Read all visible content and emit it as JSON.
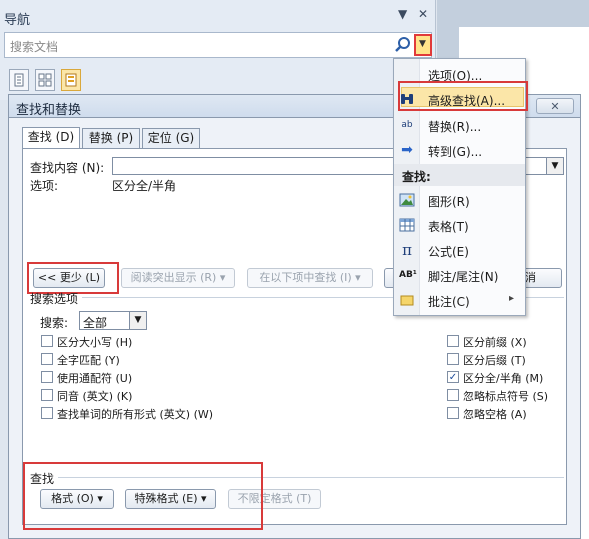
{
  "nav": {
    "title": "导航",
    "menu_glyph": "▼",
    "close_glyph": "✕",
    "search_placeholder": "搜索文档"
  },
  "dialog": {
    "title": "查找和替换",
    "close_glyph": "✕",
    "tabs": [
      {
        "label": "查找 (D)"
      },
      {
        "label": "替换 (P)"
      },
      {
        "label": "定位 (G)"
      }
    ],
    "find_label": "查找内容 (N):",
    "find_value": "",
    "options_label": "选项:",
    "options_value": "区分全/半角",
    "less_button": "<< 更少 (L)",
    "reading_highlight_button": "阅读突出显示 (R) ▾",
    "find_in_button": "在以下项中查找 (I) ▾",
    "cancel_button": "消",
    "search_options_title": "搜索选项",
    "search_label": "搜索:",
    "search_value": "全部",
    "left_options": [
      {
        "label": "区分大小写 (H)",
        "checked": false
      },
      {
        "label": "全字匹配 (Y)",
        "checked": false
      },
      {
        "label": "使用通配符 (U)",
        "checked": false
      },
      {
        "label": "同音 (英文) (K)",
        "checked": false
      },
      {
        "label": "查找单词的所有形式 (英文) (W)",
        "checked": false
      }
    ],
    "right_options": [
      {
        "label": "区分前缀 (X)",
        "checked": false
      },
      {
        "label": "区分后缀 (T)",
        "checked": false
      },
      {
        "label": "区分全/半角 (M)",
        "checked": true
      },
      {
        "label": "忽略标点符号 (S)",
        "checked": false
      },
      {
        "label": "忽略空格 (A)",
        "checked": false
      }
    ],
    "find_section_title": "查找",
    "format_button": "格式 (O) ▾",
    "special_button": "特殊格式 (E) ▾",
    "no_format_button": "不限定格式 (T)"
  },
  "menu": {
    "items": [
      {
        "label": "选项(O)...",
        "icon": ""
      },
      {
        "label": "高级查找(A)...",
        "icon": "binoculars-icon"
      },
      {
        "label": "替换(R)...",
        "icon": "replace-icon"
      },
      {
        "label": "转到(G)...",
        "icon": "arrow-right-icon"
      }
    ],
    "find_header": "查找:",
    "find_items": [
      {
        "label": "图形(R)",
        "icon": "image-icon"
      },
      {
        "label": "表格(T)",
        "icon": "table-icon"
      },
      {
        "label": "公式(E)",
        "icon": "pi-icon"
      },
      {
        "label": "脚注/尾注(N)",
        "icon": "footnote-icon"
      },
      {
        "label": "批注(C)",
        "icon": "comment-icon"
      }
    ],
    "submenu_arrow": "▸"
  },
  "colors": {
    "highlight_border": "#d83a3a",
    "menu_highlight": "#fbe6a8"
  }
}
